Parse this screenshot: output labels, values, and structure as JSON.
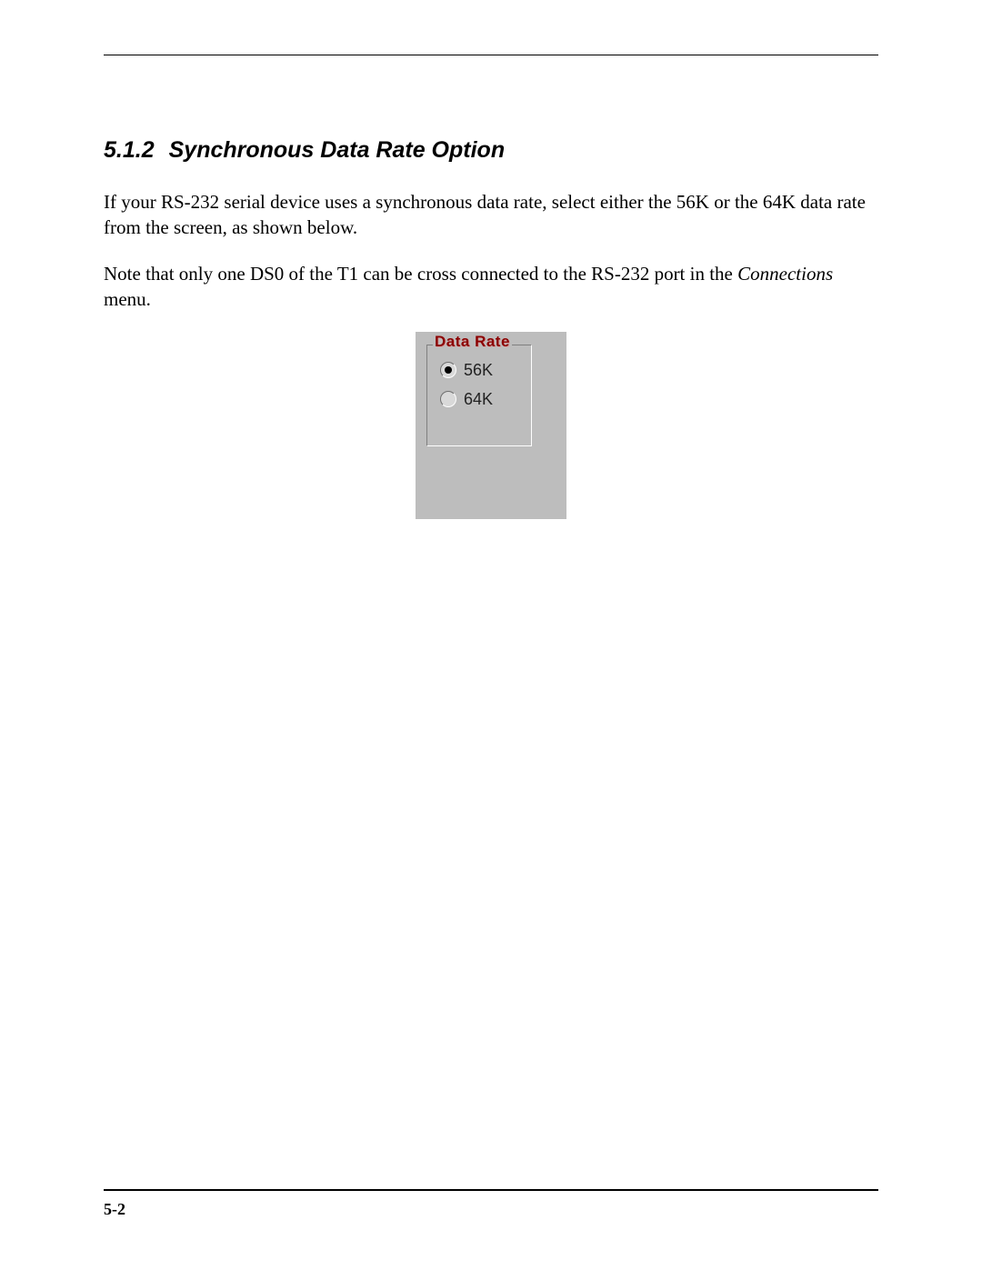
{
  "section": {
    "number": "5.1.2",
    "title": "Synchronous Data Rate Option"
  },
  "paragraphs": {
    "p1": "If your RS-232 serial device uses a synchronous data rate, select either the 56K or the 64K data rate from the screen, as shown below.",
    "p2_pre": "Note that only one DS0 of the T1 can be cross connected to the RS-232 port in the ",
    "p2_italic": "Connections",
    "p2_post": " menu."
  },
  "screenshot": {
    "legend": "Data Rate",
    "options": {
      "opt1": "56K",
      "opt2": "64K"
    },
    "selected": "56K"
  },
  "footer": {
    "page_number": "5-2"
  }
}
